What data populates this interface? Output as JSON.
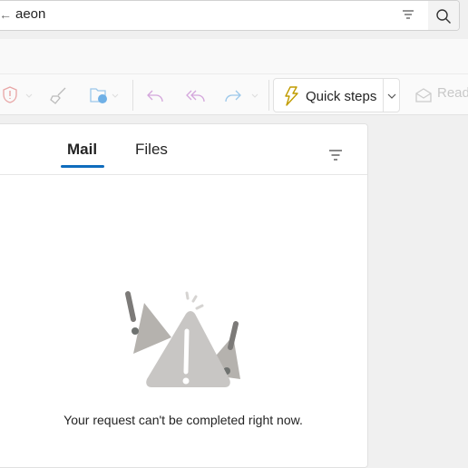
{
  "search": {
    "value": "aeon"
  },
  "toolbar": {
    "quick_steps_label": "Quick steps",
    "read_label": "Read"
  },
  "tabs": [
    {
      "label": "Mail",
      "active": true
    },
    {
      "label": "Files",
      "active": false
    }
  ],
  "empty_state": {
    "message": "Your request can't be completed right now."
  },
  "colors": {
    "accent": "#0f6cbd",
    "quick_steps_icon": "#c19c00"
  }
}
